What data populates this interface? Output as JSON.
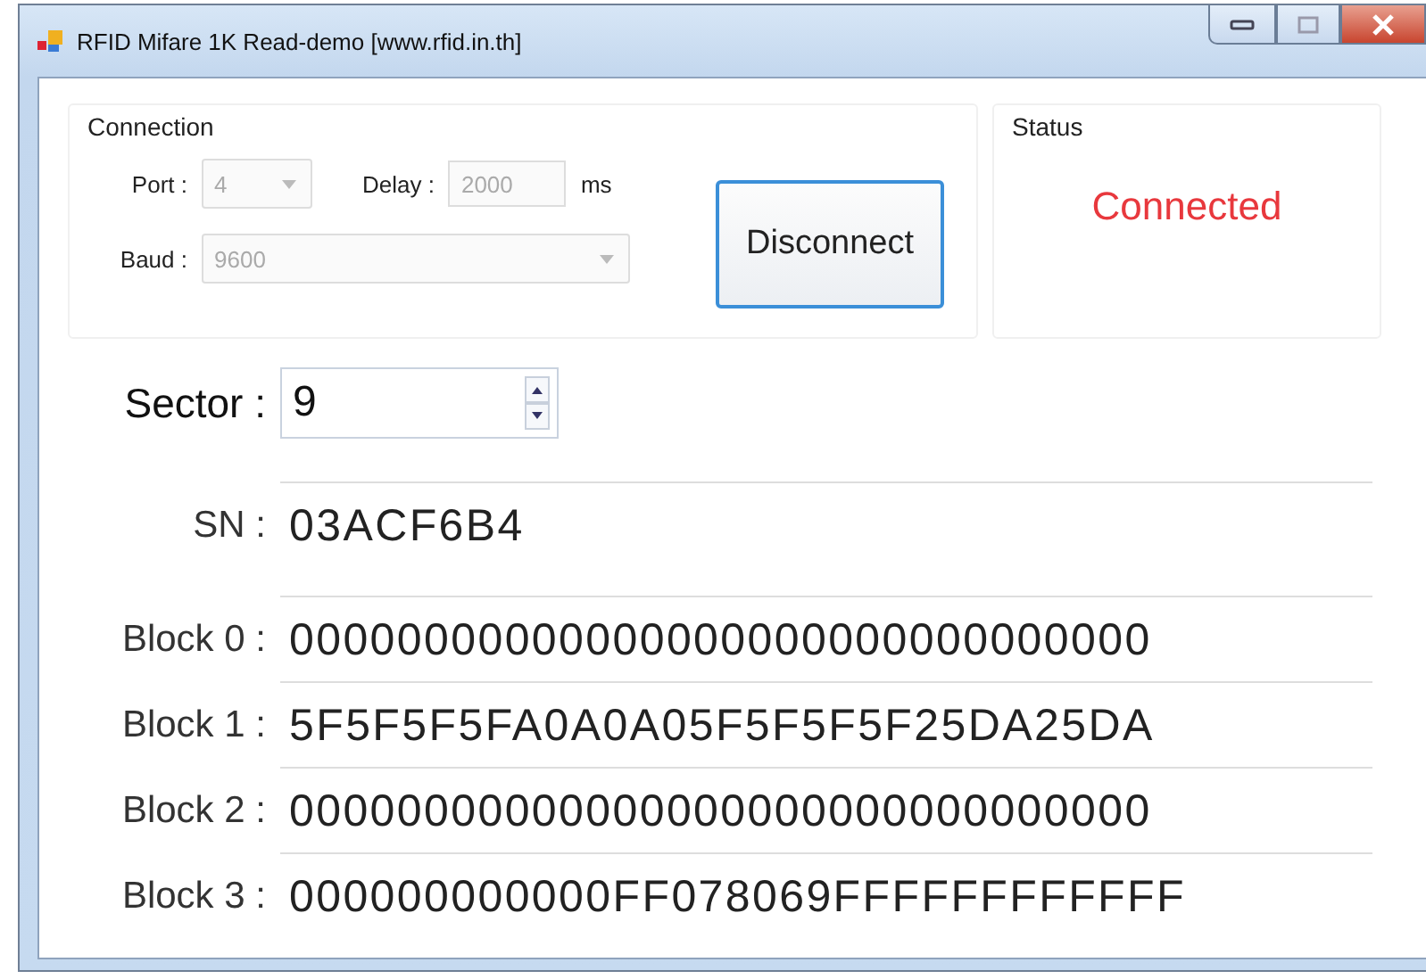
{
  "window": {
    "title": "RFID Mifare 1K Read-demo [www.rfid.in.th]"
  },
  "connection": {
    "title": "Connection",
    "port": {
      "label": "Port :",
      "value": "4",
      "disabled": true
    },
    "delay": {
      "label": "Delay :",
      "value": "2000",
      "unit": "ms",
      "disabled": true
    },
    "baud": {
      "label": "Baud :",
      "value": "9600",
      "disabled": true
    },
    "button": "Disconnect"
  },
  "status": {
    "title": "Status",
    "text": "Connected"
  },
  "sector": {
    "label": "Sector :",
    "value": "9"
  },
  "fields": [
    {
      "label": "SN :",
      "value": "03ACF6B4"
    },
    {
      "label": "Block 0 :",
      "value": "00000000000000000000000000000000"
    },
    {
      "label": "Block 1 :",
      "value": "5F5F5F5FA0A0A05F5F5F5F25DA25DA"
    },
    {
      "label": "Block 2 :",
      "value": "00000000000000000000000000000000"
    },
    {
      "label": "Block 3 :",
      "value": "000000000000FF078069FFFFFFFFFFFF"
    }
  ]
}
